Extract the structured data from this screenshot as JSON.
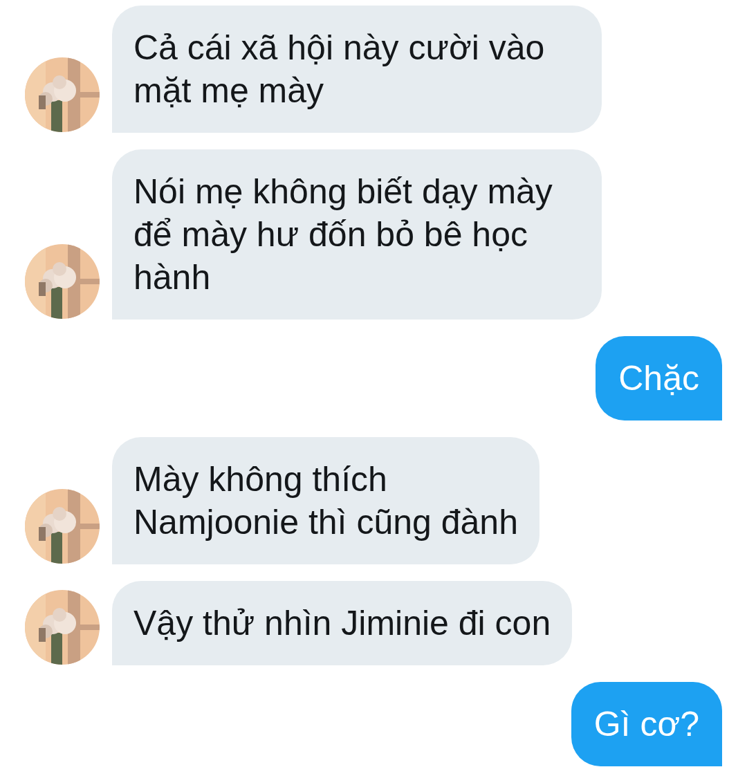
{
  "messages": [
    {
      "kind": "incoming",
      "text": "Cả cái xã hội này cười vào mặt mẹ mày"
    },
    {
      "kind": "incoming",
      "text": "Nói mẹ không biết dạy mày để mày hư đốn bỏ bê học hành"
    },
    {
      "kind": "outgoing",
      "text": "Chặc"
    },
    {
      "kind": "incoming",
      "text": "Mày không thích\nNamjoonie thì cũng đành"
    },
    {
      "kind": "incoming",
      "text": "Vậy thử nhìn Jiminie đi con"
    },
    {
      "kind": "outgoing",
      "text": "Gì cơ?"
    }
  ]
}
